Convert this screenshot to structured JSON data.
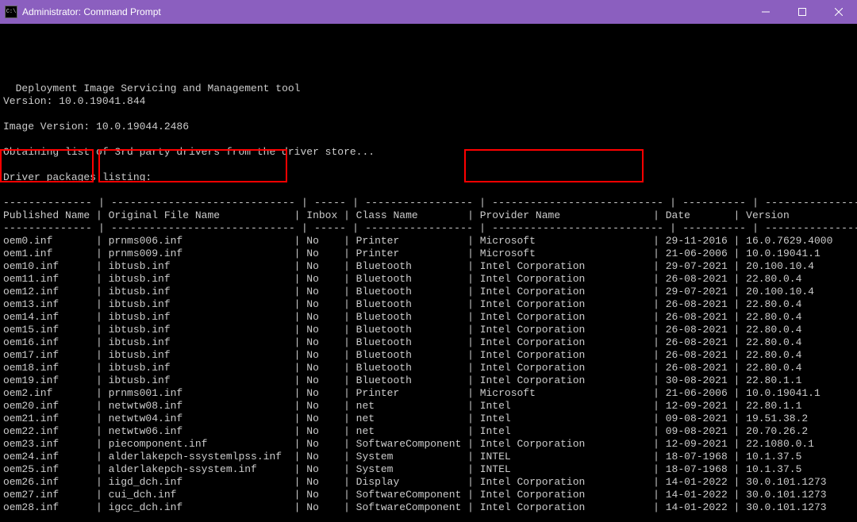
{
  "window": {
    "title": "Administrator: Command Prompt"
  },
  "preamble": {
    "tool_line": "Deployment Image Servicing and Management tool",
    "version_line": "Version: 10.0.19041.844",
    "image_version_line": "Image Version: 10.0.19044.2486",
    "obtaining_line": "Obtaining list of 3rd party drivers from the driver store...",
    "listing_line": "Driver packages listing:"
  },
  "headers": {
    "published": "Published Name",
    "original": "Original File Name",
    "inbox": "Inbox",
    "class": "Class Name",
    "provider": "Provider Name",
    "date": "Date",
    "version": "Version"
  },
  "rows": [
    {
      "pub": "oem0.inf",
      "orig": "prnms006.inf",
      "inbox": "No",
      "cls": "Printer",
      "prov": "Microsoft",
      "date": "29-11-2016",
      "ver": "16.0.7629.4000"
    },
    {
      "pub": "oem1.inf",
      "orig": "prnms009.inf",
      "inbox": "No",
      "cls": "Printer",
      "prov": "Microsoft",
      "date": "21-06-2006",
      "ver": "10.0.19041.1"
    },
    {
      "pub": "oem10.inf",
      "orig": "ibtusb.inf",
      "inbox": "No",
      "cls": "Bluetooth",
      "prov": "Intel Corporation",
      "date": "29-07-2021",
      "ver": "20.100.10.4"
    },
    {
      "pub": "oem11.inf",
      "orig": "ibtusb.inf",
      "inbox": "No",
      "cls": "Bluetooth",
      "prov": "Intel Corporation",
      "date": "26-08-2021",
      "ver": "22.80.0.4"
    },
    {
      "pub": "oem12.inf",
      "orig": "ibtusb.inf",
      "inbox": "No",
      "cls": "Bluetooth",
      "prov": "Intel Corporation",
      "date": "29-07-2021",
      "ver": "20.100.10.4"
    },
    {
      "pub": "oem13.inf",
      "orig": "ibtusb.inf",
      "inbox": "No",
      "cls": "Bluetooth",
      "prov": "Intel Corporation",
      "date": "26-08-2021",
      "ver": "22.80.0.4"
    },
    {
      "pub": "oem14.inf",
      "orig": "ibtusb.inf",
      "inbox": "No",
      "cls": "Bluetooth",
      "prov": "Intel Corporation",
      "date": "26-08-2021",
      "ver": "22.80.0.4"
    },
    {
      "pub": "oem15.inf",
      "orig": "ibtusb.inf",
      "inbox": "No",
      "cls": "Bluetooth",
      "prov": "Intel Corporation",
      "date": "26-08-2021",
      "ver": "22.80.0.4"
    },
    {
      "pub": "oem16.inf",
      "orig": "ibtusb.inf",
      "inbox": "No",
      "cls": "Bluetooth",
      "prov": "Intel Corporation",
      "date": "26-08-2021",
      "ver": "22.80.0.4"
    },
    {
      "pub": "oem17.inf",
      "orig": "ibtusb.inf",
      "inbox": "No",
      "cls": "Bluetooth",
      "prov": "Intel Corporation",
      "date": "26-08-2021",
      "ver": "22.80.0.4"
    },
    {
      "pub": "oem18.inf",
      "orig": "ibtusb.inf",
      "inbox": "No",
      "cls": "Bluetooth",
      "prov": "Intel Corporation",
      "date": "26-08-2021",
      "ver": "22.80.0.4"
    },
    {
      "pub": "oem19.inf",
      "orig": "ibtusb.inf",
      "inbox": "No",
      "cls": "Bluetooth",
      "prov": "Intel Corporation",
      "date": "30-08-2021",
      "ver": "22.80.1.1"
    },
    {
      "pub": "oem2.inf",
      "orig": "prnms001.inf",
      "inbox": "No",
      "cls": "Printer",
      "prov": "Microsoft",
      "date": "21-06-2006",
      "ver": "10.0.19041.1"
    },
    {
      "pub": "oem20.inf",
      "orig": "netwtw08.inf",
      "inbox": "No",
      "cls": "net",
      "prov": "Intel",
      "date": "12-09-2021",
      "ver": "22.80.1.1"
    },
    {
      "pub": "oem21.inf",
      "orig": "netwtw04.inf",
      "inbox": "No",
      "cls": "net",
      "prov": "Intel",
      "date": "09-08-2021",
      "ver": "19.51.38.2"
    },
    {
      "pub": "oem22.inf",
      "orig": "netwtw06.inf",
      "inbox": "No",
      "cls": "net",
      "prov": "Intel",
      "date": "09-08-2021",
      "ver": "20.70.26.2"
    },
    {
      "pub": "oem23.inf",
      "orig": "piecomponent.inf",
      "inbox": "No",
      "cls": "SoftwareComponent",
      "prov": "Intel Corporation",
      "date": "12-09-2021",
      "ver": "22.1080.0.1"
    },
    {
      "pub": "oem24.inf",
      "orig": "alderlakepch-ssystemlpss.inf",
      "inbox": "No",
      "cls": "System",
      "prov": "INTEL",
      "date": "18-07-1968",
      "ver": "10.1.37.5"
    },
    {
      "pub": "oem25.inf",
      "orig": "alderlakepch-ssystem.inf",
      "inbox": "No",
      "cls": "System",
      "prov": "INTEL",
      "date": "18-07-1968",
      "ver": "10.1.37.5"
    },
    {
      "pub": "oem26.inf",
      "orig": "iigd_dch.inf",
      "inbox": "No",
      "cls": "Display",
      "prov": "Intel Corporation",
      "date": "14-01-2022",
      "ver": "30.0.101.1273"
    },
    {
      "pub": "oem27.inf",
      "orig": "cui_dch.inf",
      "inbox": "No",
      "cls": "SoftwareComponent",
      "prov": "Intel Corporation",
      "date": "14-01-2022",
      "ver": "30.0.101.1273"
    },
    {
      "pub": "oem28.inf",
      "orig": "igcc_dch.inf",
      "inbox": "No",
      "cls": "SoftwareComponent",
      "prov": "Intel Corporation",
      "date": "14-01-2022",
      "ver": "30.0.101.1273"
    }
  ],
  "col_widths": {
    "pub": 14,
    "orig": 29,
    "inbox": 5,
    "cls": 17,
    "prov": 27,
    "date": 10,
    "ver": 15
  }
}
